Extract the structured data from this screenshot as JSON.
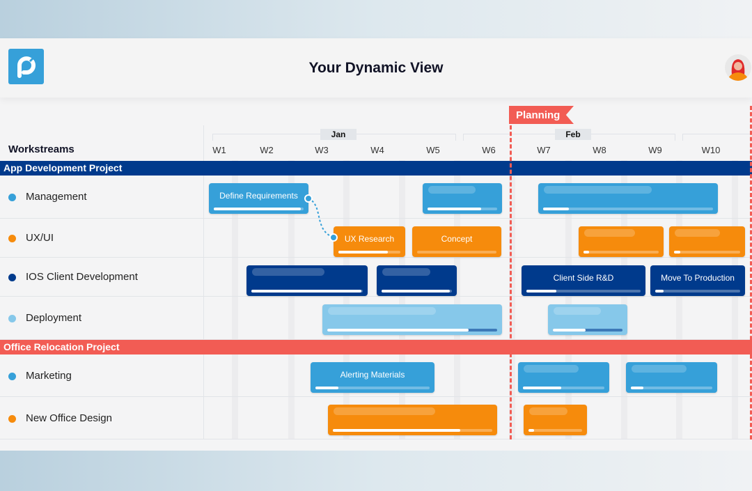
{
  "header": {
    "title": "Your Dynamic View",
    "logo_icon": "p-logo",
    "avatar_icon": "user-avatar"
  },
  "timeline": {
    "column_header": "Workstreams",
    "months": [
      "Jan",
      "Feb"
    ],
    "weeks": [
      "W1",
      "W2",
      "W3",
      "W4",
      "W5",
      "W6",
      "W7",
      "W8",
      "W9",
      "W10"
    ],
    "milestone": {
      "label": "Planning",
      "color": "#f25c54"
    }
  },
  "colors": {
    "light_blue": "#36a0d9",
    "orange": "#f68b0c",
    "navy": "#003a8c",
    "pale_blue": "#86c8ea",
    "red": "#f25c54"
  },
  "projects": [
    {
      "name": "App Development Project",
      "color": "#003a8c",
      "workstreams": [
        {
          "name": "Management",
          "color": "#36a0d9",
          "tasks": [
            {
              "label": "Define Requirements",
              "progress": 0.97
            },
            {
              "label": "",
              "progress": 0.77
            },
            {
              "label": "",
              "progress": 0.15
            }
          ]
        },
        {
          "name": "UX/UI",
          "color": "#f68b0c",
          "tasks": [
            {
              "label": "UX Research",
              "progress": 0.8
            },
            {
              "label": "Concept",
              "progress": 0
            },
            {
              "label": "",
              "progress": 0.07
            },
            {
              "label": "",
              "progress": 0.09
            }
          ]
        },
        {
          "name": "IOS Client Development",
          "color": "#003a8c",
          "tasks": [
            {
              "label": "",
              "progress": 0.99
            },
            {
              "label": "",
              "progress": 0.97
            },
            {
              "label": "Client Side R&D",
              "progress": 0.26
            },
            {
              "label": "Move To Production",
              "progress": 0.1
            }
          ]
        },
        {
          "name": "Deployment",
          "color": "#86c8ea",
          "tasks": [
            {
              "label": "",
              "progress": 0.83
            },
            {
              "label": "",
              "progress": 0.47
            }
          ]
        }
      ]
    },
    {
      "name": "Office Relocation Project",
      "color": "#f25c54",
      "workstreams": [
        {
          "name": "Marketing",
          "color": "#36a0d9",
          "tasks": [
            {
              "label": "Alerting Materials",
              "progress": 0.2
            },
            {
              "label": "",
              "progress": 0.47
            },
            {
              "label": "",
              "progress": 0.15
            }
          ]
        },
        {
          "name": "New Office Design",
          "color": "#f68b0c",
          "tasks": [
            {
              "label": "",
              "progress": 0.8
            },
            {
              "label": "",
              "progress": 0.1
            }
          ]
        }
      ]
    }
  ]
}
